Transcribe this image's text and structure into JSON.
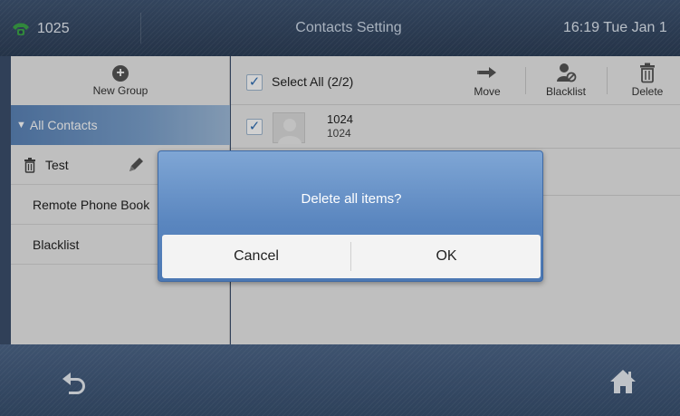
{
  "status_bar": {
    "account": "1025",
    "title": "Contacts Setting",
    "clock": "16:19 Tue Jan 1"
  },
  "sidebar": {
    "new_group_label": "New Group",
    "all_contacts_label": "All Contacts",
    "groups": [
      {
        "label": "Test"
      },
      {
        "label": "Remote Phone Book"
      },
      {
        "label": "Blacklist"
      }
    ]
  },
  "toolbar": {
    "select_all_label": "Select All (2/2)",
    "select_all_checked": true,
    "move_label": "Move",
    "blacklist_label": "Blacklist",
    "delete_label": "Delete"
  },
  "contacts": [
    {
      "name": "1024",
      "number": "1024",
      "checked": true
    }
  ],
  "dialog": {
    "message": "Delete all items?",
    "cancel_label": "Cancel",
    "ok_label": "OK"
  },
  "colors": {
    "accent": "#5a86bf",
    "checkmark": "#2e6db3",
    "phone_icon": "#3ca64a"
  },
  "icons": [
    "phone-icon",
    "plus-icon",
    "trash-icon",
    "pencil-icon",
    "move-arrow-icon",
    "blacklist-user-icon",
    "back-icon",
    "home-icon"
  ]
}
